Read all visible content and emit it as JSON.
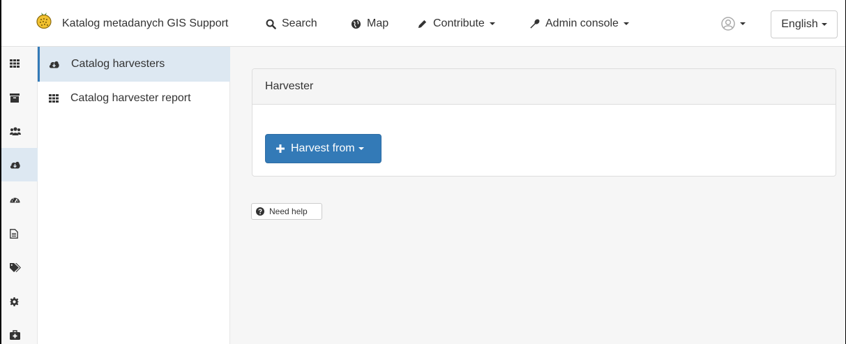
{
  "navbar": {
    "catalog_title": "Katalog metadanych GIS Support",
    "search_label": "Search",
    "map_label": "Map",
    "contribute_label": "Contribute",
    "admin_console_label": "Admin console",
    "language_label": "English"
  },
  "rail": {
    "items": [
      {
        "icon": "grid-icon"
      },
      {
        "icon": "archive-icon"
      },
      {
        "icon": "users-icon"
      },
      {
        "icon": "cloud-download-icon",
        "active": true
      },
      {
        "icon": "dashboard-icon"
      },
      {
        "icon": "file-text-icon"
      },
      {
        "icon": "tags-icon"
      },
      {
        "icon": "cog-icon"
      },
      {
        "icon": "medkit-icon"
      }
    ]
  },
  "submenu": {
    "items": [
      {
        "label": "Catalog harvesters",
        "icon": "cloud-download-icon",
        "active": true
      },
      {
        "label": "Catalog harvester report",
        "icon": "grid-icon"
      }
    ]
  },
  "main": {
    "panel_title": "Harvester",
    "harvest_button_label": "Harvest from",
    "help_button_label": "Need help"
  },
  "colors": {
    "primary": "#337ab7",
    "active_bg": "#dde8f2"
  }
}
